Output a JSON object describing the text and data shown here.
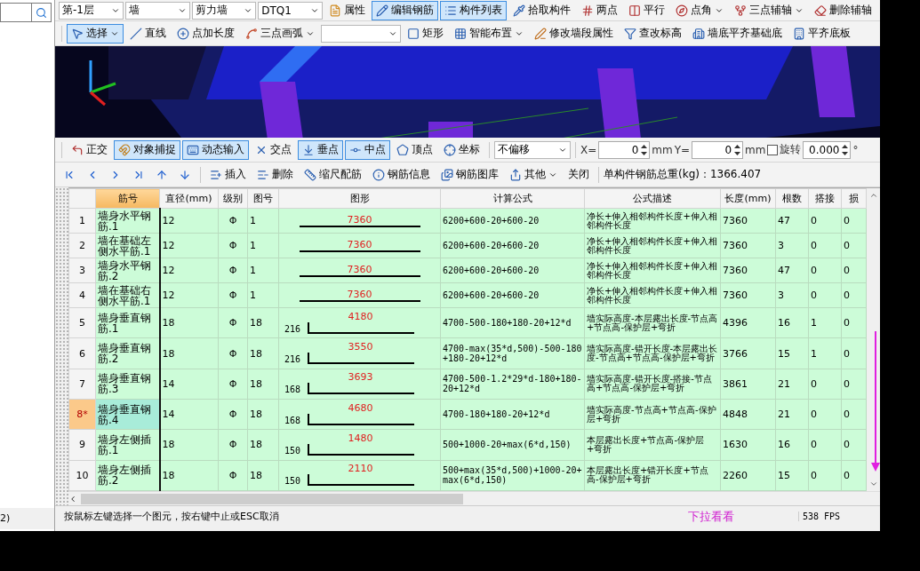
{
  "left_panel": {
    "status": "2)"
  },
  "layer_toolbar": {
    "items": [
      {
        "kind": "combo",
        "label": "第-1层"
      },
      {
        "kind": "combo",
        "label": "墙"
      },
      {
        "kind": "combo",
        "label": "剪力墙"
      },
      {
        "kind": "combo",
        "label": "DTQ1"
      },
      {
        "kind": "button",
        "label": "属性",
        "selected": false,
        "dropdown": false
      },
      {
        "kind": "button",
        "label": "编辑钢筋",
        "selected": true,
        "dropdown": false
      },
      {
        "kind": "button",
        "label": "构件列表",
        "selected": true,
        "dropdown": false
      },
      {
        "kind": "button",
        "label": "拾取构件",
        "selected": false,
        "dropdown": false
      },
      {
        "kind": "button",
        "label": "两点",
        "selected": false,
        "dropdown": false
      },
      {
        "kind": "button",
        "label": "平行",
        "selected": false,
        "dropdown": false
      },
      {
        "kind": "button",
        "label": "点角",
        "selected": false,
        "dropdown": true
      },
      {
        "kind": "button",
        "label": "三点辅轴",
        "selected": false,
        "dropdown": true
      },
      {
        "kind": "button",
        "label": "删除辅轴",
        "selected": false,
        "dropdown": false
      }
    ]
  },
  "draw_toolbar": {
    "items": [
      {
        "kind": "button",
        "label": "选择",
        "selected": true,
        "dropdown": true
      },
      {
        "kind": "button",
        "label": "直线",
        "selected": false,
        "dropdown": false
      },
      {
        "kind": "button",
        "label": "点加长度",
        "selected": false,
        "dropdown": false
      },
      {
        "kind": "button",
        "label": "三点画弧",
        "selected": false,
        "dropdown": true
      },
      {
        "kind": "combo"
      },
      {
        "kind": "button",
        "label": "矩形",
        "selected": false,
        "dropdown": false
      },
      {
        "kind": "button",
        "label": "智能布置",
        "selected": false,
        "dropdown": true
      },
      {
        "kind": "button",
        "label": "修改墙段属性",
        "selected": false,
        "dropdown": false
      },
      {
        "kind": "button",
        "label": "查改标高",
        "selected": false,
        "dropdown": false
      },
      {
        "kind": "button",
        "label": "墙底平齐基础底",
        "selected": false,
        "dropdown": false
      },
      {
        "kind": "button",
        "label": "平齐底板",
        "selected": false,
        "dropdown": false
      }
    ]
  },
  "snap_toolbar": {
    "items": [
      {
        "label": "正交",
        "selected": false
      },
      {
        "label": "对象捕捉",
        "selected": true
      },
      {
        "label": "动态输入",
        "selected": true
      },
      {
        "label": "交点",
        "selected": false
      },
      {
        "label": "垂点",
        "selected": true
      },
      {
        "label": "中点",
        "selected": true
      },
      {
        "label": "顶点",
        "selected": false
      },
      {
        "label": "坐标",
        "selected": false
      }
    ],
    "offset": {
      "value": "不偏移"
    },
    "x": {
      "label": "X=",
      "value": "0",
      "unit": "mm"
    },
    "y": {
      "label": "Y=",
      "value": "0",
      "unit": "mm"
    },
    "rotate": {
      "checked": false,
      "label": "旋转",
      "value": "0.000",
      "unit": "°"
    }
  },
  "rebar_toolbar": {
    "items": [
      {
        "label": "插入",
        "dropdown": false
      },
      {
        "label": "删除",
        "dropdown": false
      },
      {
        "label": "缩尺配筋",
        "dropdown": false
      },
      {
        "label": "钢筋信息",
        "dropdown": false
      },
      {
        "label": "钢筋图库",
        "dropdown": false
      },
      {
        "label": "其他",
        "dropdown": true
      },
      {
        "label": "关闭",
        "dropdown": false
      }
    ],
    "total": "单构件钢筋总重(kg)：1366.407"
  },
  "table": {
    "columns": [
      {
        "label": "筋号",
        "selected": true
      },
      {
        "label": "直径(mm)",
        "selected": false
      },
      {
        "label": "级别",
        "selected": false
      },
      {
        "label": "图号",
        "selected": false
      },
      {
        "label": "图形",
        "selected": false
      },
      {
        "label": "计算公式",
        "selected": false
      },
      {
        "label": "公式描述",
        "selected": false
      },
      {
        "label": "长度(mm)",
        "selected": false
      },
      {
        "label": "根数",
        "selected": false
      },
      {
        "label": "搭接",
        "selected": false
      },
      {
        "label": "损",
        "selected": false
      }
    ],
    "rows": [
      {
        "num": "1",
        "selected": false,
        "name": "墙身水平钢筋.1",
        "diameter": "12",
        "grade": "Φ",
        "shape_no": "1",
        "shape": {
          "kind": "straight",
          "length": "7360"
        },
        "formula": "6200+600-20+600-20",
        "description": "净长+伸入相邻构件长度+伸入相邻构件长度",
        "length": "7360",
        "count": "47",
        "lap": "0",
        "loss": "0"
      },
      {
        "num": "2",
        "selected": false,
        "name": "墙在基础左侧水平筋.1",
        "diameter": "12",
        "grade": "Φ",
        "shape_no": "1",
        "shape": {
          "kind": "straight",
          "length": "7360"
        },
        "formula": "6200+600-20+600-20",
        "description": "净长+伸入相邻构件长度+伸入相邻构件长度",
        "length": "7360",
        "count": "3",
        "lap": "0",
        "loss": "0"
      },
      {
        "num": "3",
        "selected": false,
        "name": "墙身水平钢筋.2",
        "diameter": "12",
        "grade": "Φ",
        "shape_no": "1",
        "shape": {
          "kind": "straight",
          "length": "7360"
        },
        "formula": "6200+600-20+600-20",
        "description": "净长+伸入相邻构件长度+伸入相邻构件长度",
        "length": "7360",
        "count": "47",
        "lap": "0",
        "loss": "0"
      },
      {
        "num": "4",
        "selected": false,
        "name": "墙在基础右侧水平筋.1",
        "diameter": "12",
        "grade": "Φ",
        "shape_no": "1",
        "shape": {
          "kind": "straight",
          "length": "7360"
        },
        "formula": "6200+600-20+600-20",
        "description": "净长+伸入相邻构件长度+伸入相邻构件长度",
        "length": "7360",
        "count": "3",
        "lap": "0",
        "loss": "0"
      },
      {
        "num": "5",
        "selected": false,
        "name": "墙身垂直钢筋.1",
        "diameter": "18",
        "grade": "Φ",
        "shape_no": "18",
        "shape": {
          "kind": "hook",
          "hook": "216",
          "length": "4180"
        },
        "formula": "4700-500-180+180-20+12*d",
        "description": "墙实际高度-本层露出长度-节点高+节点高-保护层+弯折",
        "length": "4396",
        "count": "16",
        "lap": "1",
        "loss": "0"
      },
      {
        "num": "6",
        "selected": false,
        "name": "墙身垂直钢筋.2",
        "diameter": "18",
        "grade": "Φ",
        "shape_no": "18",
        "shape": {
          "kind": "hook",
          "hook": "216",
          "length": "3550"
        },
        "formula": "4700-max(35*d,500)-500-180+180-20+12*d",
        "description": "墙实际高度-错开长度-本层露出长度-节点高+节点高-保护层+弯折",
        "length": "3766",
        "count": "15",
        "lap": "1",
        "loss": "0"
      },
      {
        "num": "7",
        "selected": false,
        "name": "墙身垂直钢筋.3",
        "diameter": "14",
        "grade": "Φ",
        "shape_no": "18",
        "shape": {
          "kind": "hook",
          "hook": "168",
          "length": "3693"
        },
        "formula": "4700-500-1.2*29*d-180+180-20+12*d",
        "description": "墙实际高度-错开长度-搭接-节点高+节点高-保护层+弯折",
        "length": "3861",
        "count": "21",
        "lap": "0",
        "loss": "0"
      },
      {
        "num": "8*",
        "selected": true,
        "name": "墙身垂直钢筋.4",
        "diameter": "14",
        "grade": "Φ",
        "shape_no": "18",
        "shape": {
          "kind": "hook",
          "hook": "168",
          "length": "4680"
        },
        "formula": "4700-180+180-20+12*d",
        "description": "墙实际高度-节点高+节点高-保护层+弯折",
        "length": "4848",
        "count": "21",
        "lap": "0",
        "loss": "0"
      },
      {
        "num": "9",
        "selected": false,
        "name": "墙身左侧插筋.1",
        "diameter": "18",
        "grade": "Φ",
        "shape_no": "18",
        "shape": {
          "kind": "hook",
          "hook": "150",
          "length": "1480"
        },
        "formula": "500+1000-20+max(6*d,150)",
        "description": "本层露出长度+节点高-保护层+弯折",
        "length": "1630",
        "count": "16",
        "lap": "0",
        "loss": "0"
      },
      {
        "num": "10",
        "selected": false,
        "name": "墙身左侧插筋.2",
        "diameter": "18",
        "grade": "Φ",
        "shape_no": "18",
        "shape": {
          "kind": "hook",
          "hook": "150",
          "length": "2110"
        },
        "formula": "500+max(35*d,500)+1000-20+max(6*d,150)",
        "description": "本层露出长度+错开长度+节点高-保护层+弯折",
        "length": "2260",
        "count": "15",
        "lap": "0",
        "loss": "0"
      }
    ]
  },
  "status_bar": {
    "message": "按鼠标左键选择一个图元，按右键中止或ESC取消",
    "hint": "下拉看看",
    "fps": "538 FPS"
  }
}
